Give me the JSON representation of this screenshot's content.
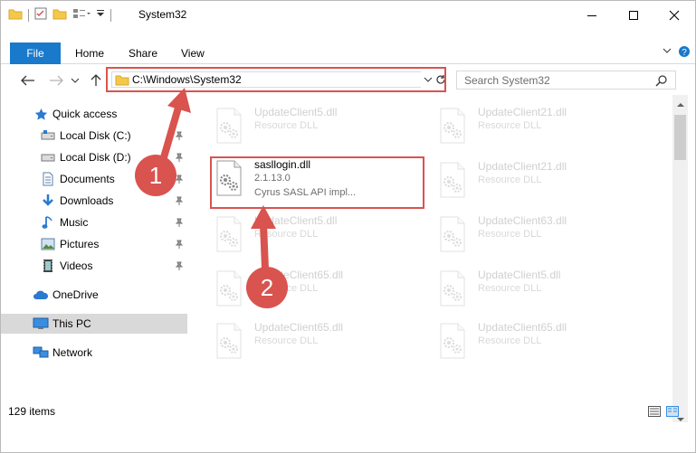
{
  "window": {
    "title": "System32",
    "minimize_label": "",
    "maximize_label": "",
    "close_label": ""
  },
  "ribbon": {
    "file_tab": "File",
    "tabs": [
      "Home",
      "Share",
      "View"
    ]
  },
  "address_bar": {
    "path": "C:\\Windows\\System32"
  },
  "search": {
    "placeholder": "Search System32"
  },
  "nav_pane": {
    "items": [
      {
        "label": "Quick access",
        "icon": "star-icon",
        "pinned": false
      },
      {
        "label": "Local Disk (C:)",
        "icon": "drive-icon",
        "pinned": true
      },
      {
        "label": "Local Disk (D:)",
        "icon": "drive-icon",
        "pinned": true
      },
      {
        "label": "Documents",
        "icon": "documents-icon",
        "pinned": true
      },
      {
        "label": "Downloads",
        "icon": "downloads-icon",
        "pinned": true
      },
      {
        "label": "Music",
        "icon": "music-icon",
        "pinned": true
      },
      {
        "label": "Pictures",
        "icon": "pictures-icon",
        "pinned": true
      },
      {
        "label": "Videos",
        "icon": "videos-icon",
        "pinned": true
      },
      {
        "label": "OneDrive",
        "icon": "onedrive-icon",
        "pinned": false
      },
      {
        "label": "This PC",
        "icon": "this-pc-icon",
        "pinned": false,
        "selected": true
      },
      {
        "label": "Network",
        "icon": "network-icon",
        "pinned": false
      }
    ]
  },
  "files": [
    {
      "name": "UpdateClient5.dll",
      "type": "Resource DLL",
      "faded": true
    },
    {
      "name": "UpdateClient21.dll",
      "type": "Resource DLL",
      "faded": true
    },
    {
      "name": "sasllogin.dll",
      "version": "2.1.13.0",
      "description": "Cyrus SASL API impl...",
      "faded": false
    },
    {
      "name": "UpdateClient21.dll",
      "type": "Resource DLL",
      "faded": true
    },
    {
      "name": "UpdateClient5.dll",
      "type": "Resource DLL",
      "faded": true
    },
    {
      "name": "UpdateClient63.dll",
      "type": "Resource DLL",
      "faded": true
    },
    {
      "name": "UpdateClient65.dll",
      "type": "Resource DLL",
      "faded": true
    },
    {
      "name": "UpdateClient5.dll",
      "type": "Resource DLL",
      "faded": true
    },
    {
      "name": "UpdateClient65.dll",
      "type": "Resource DLL",
      "faded": true
    },
    {
      "name": "UpdateClient65.dll",
      "type": "Resource DLL",
      "faded": true
    }
  ],
  "status": {
    "item_count": "129 items"
  },
  "annotations": {
    "badge_1": "1",
    "badge_2": "2",
    "color": "#d9534f"
  },
  "colors": {
    "accent": "#1979ca",
    "selection": "#d9d9d9",
    "highlight": "#d9534f"
  }
}
